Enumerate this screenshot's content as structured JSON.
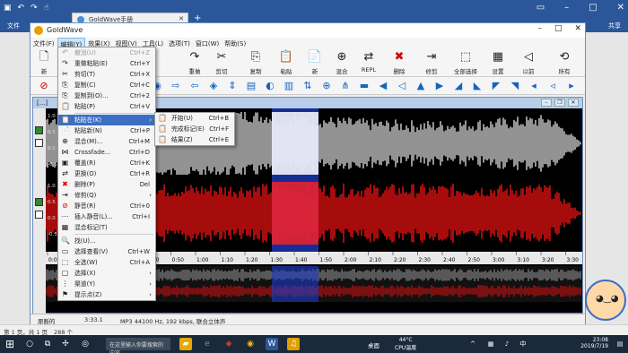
{
  "word": {
    "title_text": "",
    "file_tab": "文件",
    "share": "共享",
    "status_pages": "第 1 页，共 1 页",
    "status_words": "288 个"
  },
  "browser": {
    "tab_title": "GoldWave手册"
  },
  "goldwave": {
    "title": "GoldWave",
    "menu": [
      "文件(F)",
      "编辑(Y)",
      "效果(X)",
      "视图(V)",
      "工具(L)",
      "选项(T)",
      "窗口(W)",
      "帮助(S)"
    ],
    "active_menu_index": 1,
    "toolbar": [
      {
        "label": "新",
        "icon": "new-doc-icon"
      },
      {
        "label": "打开",
        "icon": "open-folder-icon"
      },
      {
        "label": "保存",
        "icon": "save-icon"
      },
      {
        "label": "撤消",
        "icon": "undo-icon"
      },
      {
        "label": "重做",
        "icon": "redo-icon"
      },
      {
        "label": "剪切",
        "icon": "cut-icon"
      },
      {
        "label": "复制",
        "icon": "copy-icon"
      },
      {
        "label": "粘贴",
        "icon": "paste-icon"
      },
      {
        "label": "新",
        "icon": "paste-new-icon"
      },
      {
        "label": "混合",
        "icon": "mix-icon"
      },
      {
        "label": "REPL",
        "icon": "replace-icon"
      },
      {
        "label": "删除",
        "icon": "delete-icon"
      },
      {
        "label": "修剪",
        "icon": "trim-icon"
      },
      {
        "label": "全部选择",
        "icon": "select-all-icon"
      },
      {
        "label": "设置",
        "icon": "set-icon"
      },
      {
        "label": "以前",
        "icon": "previous-icon"
      },
      {
        "label": "所有",
        "icon": "all-icon"
      }
    ],
    "status": {
      "label": "原断的",
      "time": "3:33.1",
      "format": "MP3 44100 Hz, 192 kbps, 联合立体声"
    },
    "timeline": [
      "0:00",
      "0:10",
      "0:20",
      "0:30",
      "0:40",
      "0:50",
      "1:00",
      "1:10",
      "1:20",
      "1:30",
      "1:40",
      "1:50",
      "2:00",
      "2:10",
      "2:20",
      "2:30",
      "2:40",
      "2:50",
      "3:00",
      "3:10",
      "3:20",
      "3:30"
    ],
    "y_ticks": [
      "1.0",
      "0.5",
      "0.0",
      "-0.5",
      "1.0",
      "0.5",
      "0.0",
      "-0.5"
    ]
  },
  "edit_menu": [
    {
      "label": "撤消(U)",
      "shortcut": "Ctrl+Z",
      "disabled": true,
      "icon": "undo-icon"
    },
    {
      "label": "重做粘贴(E)",
      "shortcut": "Ctrl+Y",
      "disabled": false,
      "icon": "redo-icon"
    },
    {
      "label": "剪切(T)",
      "shortcut": "Ctrl+X",
      "disabled": false,
      "icon": "cut-icon"
    },
    {
      "label": "复制(C)",
      "shortcut": "Ctrl+C",
      "disabled": false,
      "icon": "copy-icon"
    },
    {
      "label": "复制到(O)...",
      "shortcut": "Ctrl+2",
      "disabled": false,
      "icon": "copy-to-icon"
    },
    {
      "label": "粘贴(P)",
      "shortcut": "Ctrl+V",
      "disabled": false,
      "icon": "paste-icon"
    },
    {
      "label": "粘贴在(K)",
      "shortcut": "",
      "disabled": false,
      "icon": "paste-at-icon",
      "submenu": true,
      "highlight": true
    },
    {
      "label": "粘贴新(N)",
      "shortcut": "Ctrl+P",
      "disabled": false,
      "icon": "paste-new-icon"
    },
    {
      "label": "混合(M)...",
      "shortcut": "Ctrl+M",
      "disabled": false,
      "icon": "mix-icon"
    },
    {
      "label": "Crossfade...",
      "shortcut": "Ctrl+D",
      "disabled": false,
      "icon": "crossfade-icon"
    },
    {
      "label": "覆盖(R)",
      "shortcut": "Ctrl+K",
      "disabled": false,
      "icon": "overwrite-icon"
    },
    {
      "label": "更换(O)",
      "shortcut": "Ctrl+R",
      "disabled": false,
      "icon": "replace-icon"
    },
    {
      "label": "删除(P)",
      "shortcut": "Del",
      "disabled": false,
      "icon": "delete-icon"
    },
    {
      "label": "修剪(Q)",
      "shortcut": "",
      "disabled": false,
      "icon": "trim-icon",
      "submenu": true
    },
    {
      "label": "静音(R)",
      "shortcut": "Ctrl+0",
      "disabled": false,
      "icon": "mute-icon"
    },
    {
      "label": "插入静音(L)...",
      "shortcut": "Ctrl+I",
      "disabled": false,
      "icon": "insert-silence-icon"
    },
    {
      "label": "混合标记(T)",
      "shortcut": "",
      "disabled": false,
      "icon": "mix-marker-icon"
    },
    {
      "label": "找(U)...",
      "shortcut": "",
      "disabled": false,
      "icon": "find-icon"
    },
    {
      "label": "选择查看(V)",
      "shortcut": "Ctrl+W",
      "disabled": false,
      "icon": "select-view-icon"
    },
    {
      "label": "全选(W)",
      "shortcut": "Ctrl+A",
      "disabled": false,
      "icon": "select-all-icon"
    },
    {
      "label": "选择(X)",
      "shortcut": "",
      "disabled": false,
      "icon": "select-icon",
      "submenu": true
    },
    {
      "label": "渠道(Y)",
      "shortcut": "",
      "disabled": false,
      "icon": "channel-icon",
      "submenu": true
    },
    {
      "label": "提示点(Z)",
      "shortcut": "",
      "disabled": false,
      "icon": "cue-point-icon",
      "submenu": true
    }
  ],
  "paste_at_submenu": [
    {
      "label": "开始(U)",
      "shortcut": "Ctrl+B"
    },
    {
      "label": "完成标记(E)",
      "shortcut": "Ctrl+F"
    },
    {
      "label": "结果(Z)",
      "shortcut": "Ctrl+E"
    }
  ],
  "taskbar": {
    "search_placeholder": "在这里输入你要搜索的内容",
    "desktop_label": "桌面",
    "temp": "44°C",
    "temp_label": "CPU温度",
    "time": "23:08",
    "date": "2019/7/19"
  },
  "colors": {
    "word_blue": "#2b579a",
    "wave_top": "#b8b8b8",
    "wave_bottom": "#d01010",
    "selection": "#1e3cc8",
    "menu_highlight": "#3a6fc4"
  }
}
